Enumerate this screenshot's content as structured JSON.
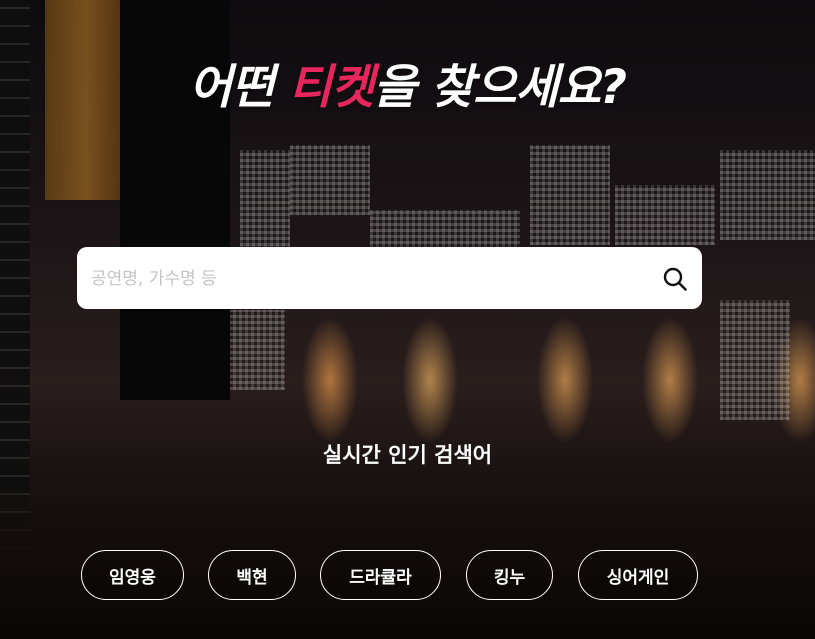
{
  "hero": {
    "headline_pre": "어떤 ",
    "headline_accent": "티켓",
    "headline_post": "을 찾으세요?",
    "accent_color": "#e8265e"
  },
  "search": {
    "placeholder": "공연명, 가수명 등",
    "value": "",
    "icon": "search-icon"
  },
  "trending": {
    "title": "실시간 인기 검색어",
    "tags": [
      {
        "label": "임영웅"
      },
      {
        "label": "백현"
      },
      {
        "label": "드라큘라"
      },
      {
        "label": "킹누"
      },
      {
        "label": "싱어게인"
      }
    ]
  }
}
